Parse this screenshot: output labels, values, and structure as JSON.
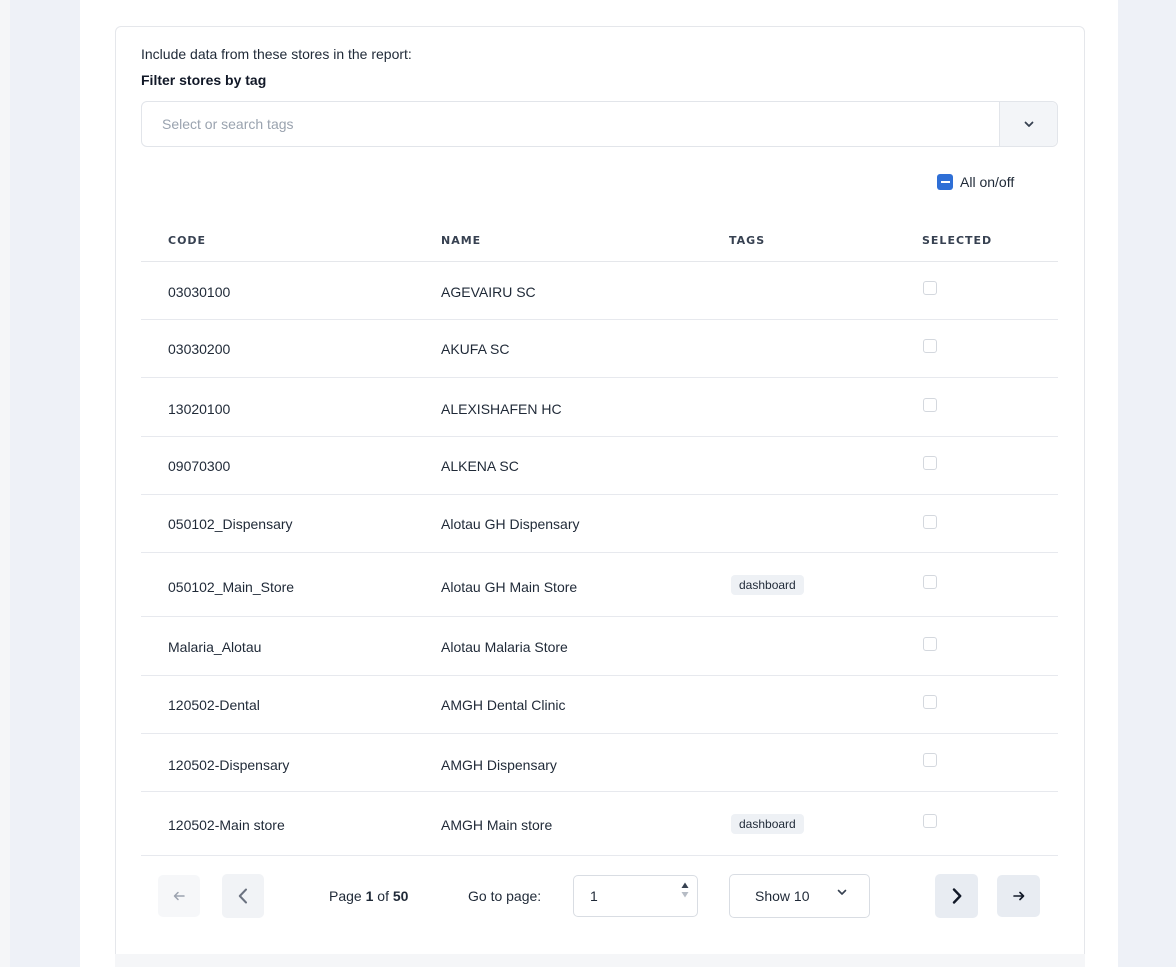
{
  "intro": "Include data from these stores in the report:",
  "filter": {
    "label": "Filter stores by tag",
    "placeholder": "Select or search tags"
  },
  "all_toggle": "All on/off",
  "columns": {
    "code": "CODE",
    "name": "NAME",
    "tags": "TAGS",
    "selected": "SELECTED"
  },
  "rows": [
    {
      "code": "03030100",
      "name": "AGEVAIRU SC",
      "tag": "",
      "selected": false
    },
    {
      "code": "03030200",
      "name": "AKUFA SC",
      "tag": "",
      "selected": false
    },
    {
      "code": "13020100",
      "name": "ALEXISHAFEN HC",
      "tag": "",
      "selected": false
    },
    {
      "code": "09070300",
      "name": "ALKENA SC",
      "tag": "",
      "selected": false
    },
    {
      "code": "050102_Dispensary",
      "name": "Alotau GH Dispensary",
      "tag": "",
      "selected": false
    },
    {
      "code": "050102_Main_Store",
      "name": "Alotau GH Main Store",
      "tag": "dashboard",
      "selected": false
    },
    {
      "code": "Malaria_Alotau",
      "name": "Alotau Malaria Store",
      "tag": "",
      "selected": false
    },
    {
      "code": "120502-Dental",
      "name": "AMGH Dental Clinic",
      "tag": "",
      "selected": false
    },
    {
      "code": "120502-Dispensary",
      "name": "AMGH Dispensary",
      "tag": "",
      "selected": false
    },
    {
      "code": "120502-Main store",
      "name": "AMGH Main store",
      "tag": "dashboard",
      "selected": false
    }
  ],
  "pagination": {
    "page_prefix": "Page",
    "current_page": "1",
    "of_word": "of",
    "total_pages": "50",
    "goto_label": "Go to page:",
    "goto_value": "1",
    "show_label": "Show 10"
  },
  "colors": {
    "accent": "#2f6fd6",
    "tag_bg": "#eef1f5",
    "side_bg": "#eef1f7"
  }
}
